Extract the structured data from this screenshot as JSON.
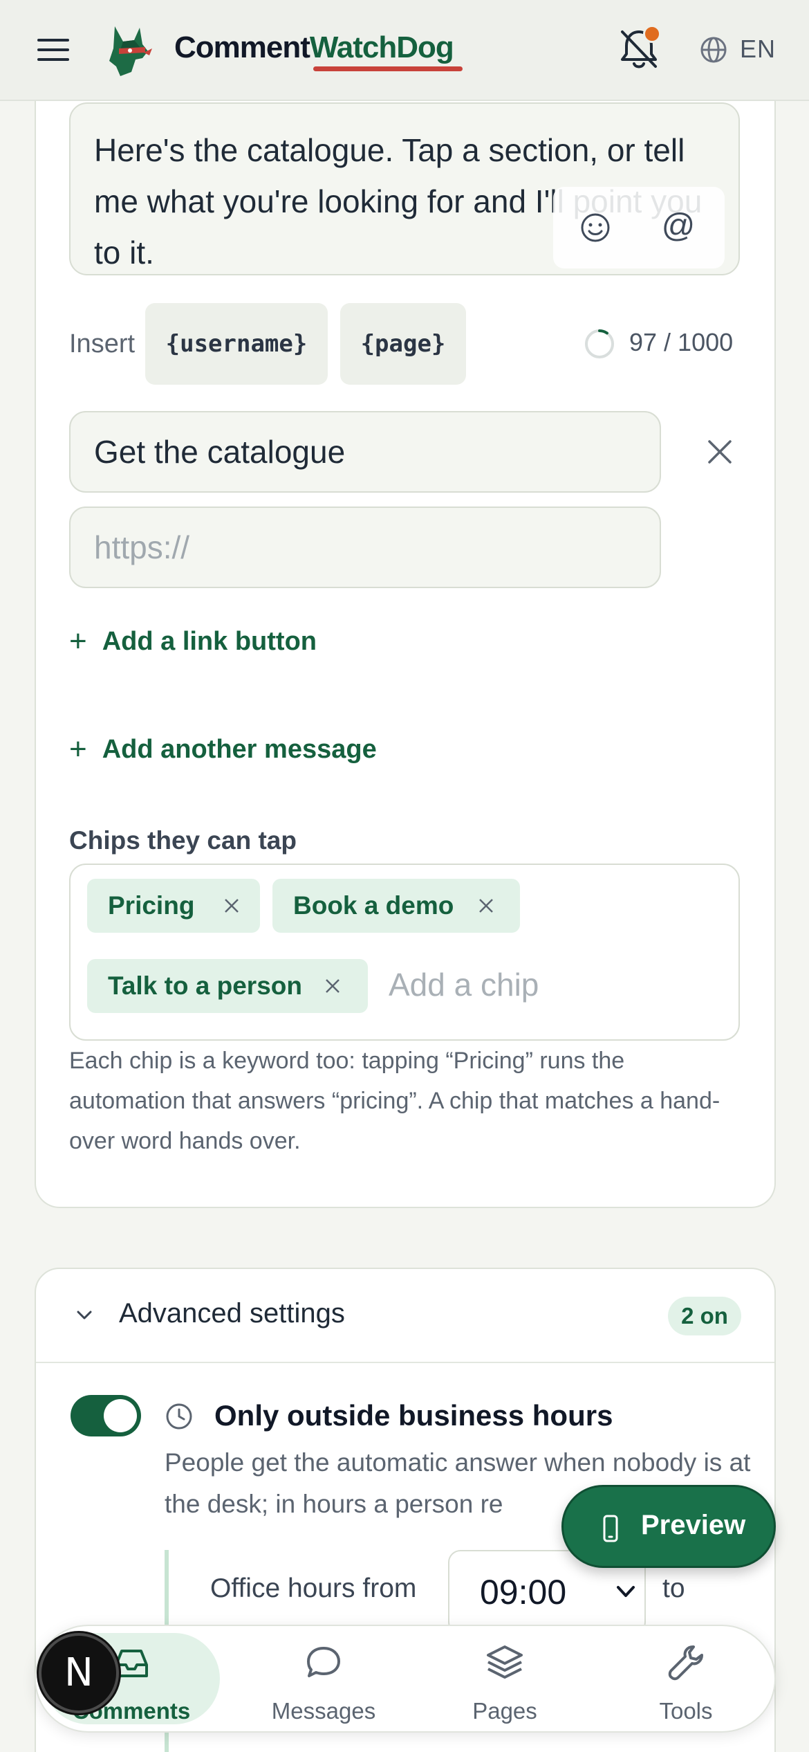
{
  "header": {
    "brand_part1": "Comment",
    "brand_part2": "WatchDog",
    "language": "EN"
  },
  "message": {
    "text": "Here's the catalogue. Tap a section, or tell me what you're looking for and I'll point you to it.",
    "insert_label": "Insert",
    "tokens": [
      "{username}",
      "{page}"
    ],
    "char_count": "97 / 1000",
    "char_fraction": 0.097
  },
  "link_button": {
    "label_value": "Get the catalogue",
    "url_placeholder": "https://",
    "add_link_label": "Add a link button",
    "add_message_label": "Add another message"
  },
  "chips": {
    "label": "Chips they can tap",
    "items": [
      "Pricing",
      "Book a demo",
      "Talk to a person"
    ],
    "input_placeholder": "Add a chip",
    "help": "Each chip is a keyword too: tapping “Pricing” runs the automation that answers “pricing”. A chip that matches a hand-over word hands over."
  },
  "advanced": {
    "title": "Advanced settings",
    "badge": "2 on",
    "option_title": "Only outside business hours",
    "option_desc": "People get the automatic answer when nobody is at the desk; in hours a person re",
    "toggle_on": true,
    "hours_from_label": "Office hours from",
    "from_value": "09:00",
    "to_label": "to"
  },
  "preview_label": "Preview",
  "nav": {
    "items": [
      "Comments",
      "Messages",
      "Pages",
      "Tools"
    ],
    "active": "Comments"
  },
  "badge_letter": "N",
  "colors": {
    "accent": "#15603e",
    "accent_light": "#e2f2e8",
    "brand_underline": "#c8423a",
    "notification_dot": "#e06c1f"
  }
}
